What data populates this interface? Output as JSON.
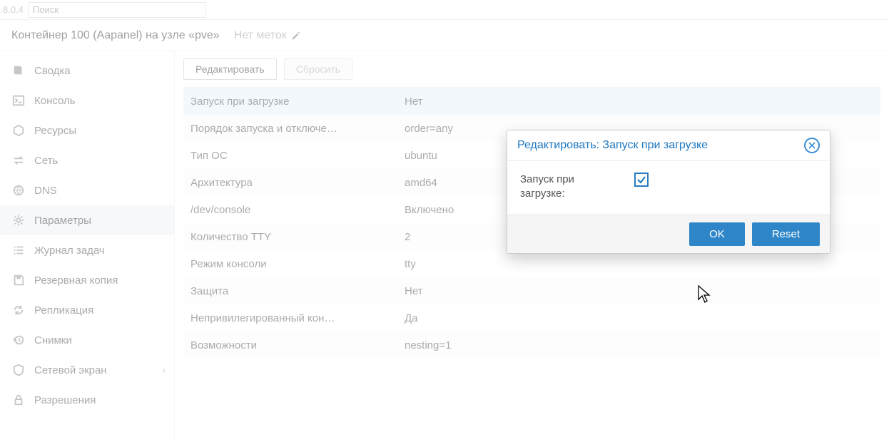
{
  "top": {
    "version": "8.0.4",
    "search_placeholder": "Поиск"
  },
  "header": {
    "title": "Контейнер 100 (Aapanel) на узле «pve»",
    "tags": "Нет меток"
  },
  "sidebar": {
    "items": [
      {
        "label": "Сводка",
        "icon": "book"
      },
      {
        "label": "Консоль",
        "icon": "terminal"
      },
      {
        "label": "Ресурсы",
        "icon": "cube"
      },
      {
        "label": "Сеть",
        "icon": "exchange"
      },
      {
        "label": "DNS",
        "icon": "globe"
      },
      {
        "label": "Параметры",
        "icon": "gear",
        "selected": true
      },
      {
        "label": "Журнал задач",
        "icon": "list"
      },
      {
        "label": "Резервная копия",
        "icon": "save"
      },
      {
        "label": "Репликация",
        "icon": "refresh"
      },
      {
        "label": "Снимки",
        "icon": "history"
      },
      {
        "label": "Сетевой экран",
        "icon": "shield",
        "expand": true
      },
      {
        "label": "Разрешения",
        "icon": "lock"
      }
    ]
  },
  "toolbar": {
    "edit": "Редактировать",
    "reset": "Сбросить"
  },
  "options": [
    {
      "key": "Запуск при загрузке",
      "val": "Нет",
      "selected": true
    },
    {
      "key": "Порядок запуска и отключе…",
      "val": "order=any"
    },
    {
      "key": "Тип ОС",
      "val": "ubuntu"
    },
    {
      "key": "Архитектура",
      "val": "amd64"
    },
    {
      "key": "/dev/console",
      "val": "Включено"
    },
    {
      "key": "Количество TTY",
      "val": "2"
    },
    {
      "key": "Режим консоли",
      "val": "tty"
    },
    {
      "key": "Защита",
      "val": "Нет"
    },
    {
      "key": "Непривилегированный кон…",
      "val": "Да"
    },
    {
      "key": "Возможности",
      "val": "nesting=1"
    }
  ],
  "dialog": {
    "title": "Редактировать: Запуск при загрузке",
    "field_label": "Запуск при загрузке:",
    "checked": true,
    "ok": "OK",
    "reset": "Reset"
  }
}
